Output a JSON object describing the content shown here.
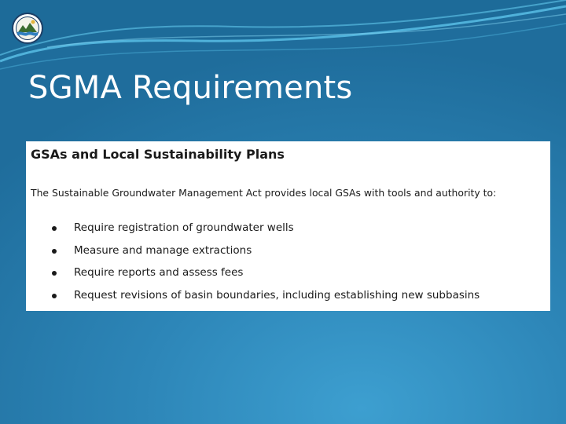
{
  "slide": {
    "title": "SGMA Requirements",
    "logo_icon": "state-water-seal-icon"
  },
  "content": {
    "heading": "GSAs and Local Sustainability Plans",
    "intro": "The Sustainable Groundwater Management Act provides local GSAs with tools and authority to:",
    "bullets": [
      "Require registration of groundwater wells",
      "Measure and manage extractions",
      "Require reports and assess fees",
      "Request revisions of basin boundaries, including establishing new subbasins"
    ]
  },
  "colors": {
    "background_light": "#3d9fd0",
    "background_dark": "#1f6d9c",
    "title_text": "#ffffff",
    "box_background": "#ffffff",
    "body_text": "#1a1a1a"
  }
}
